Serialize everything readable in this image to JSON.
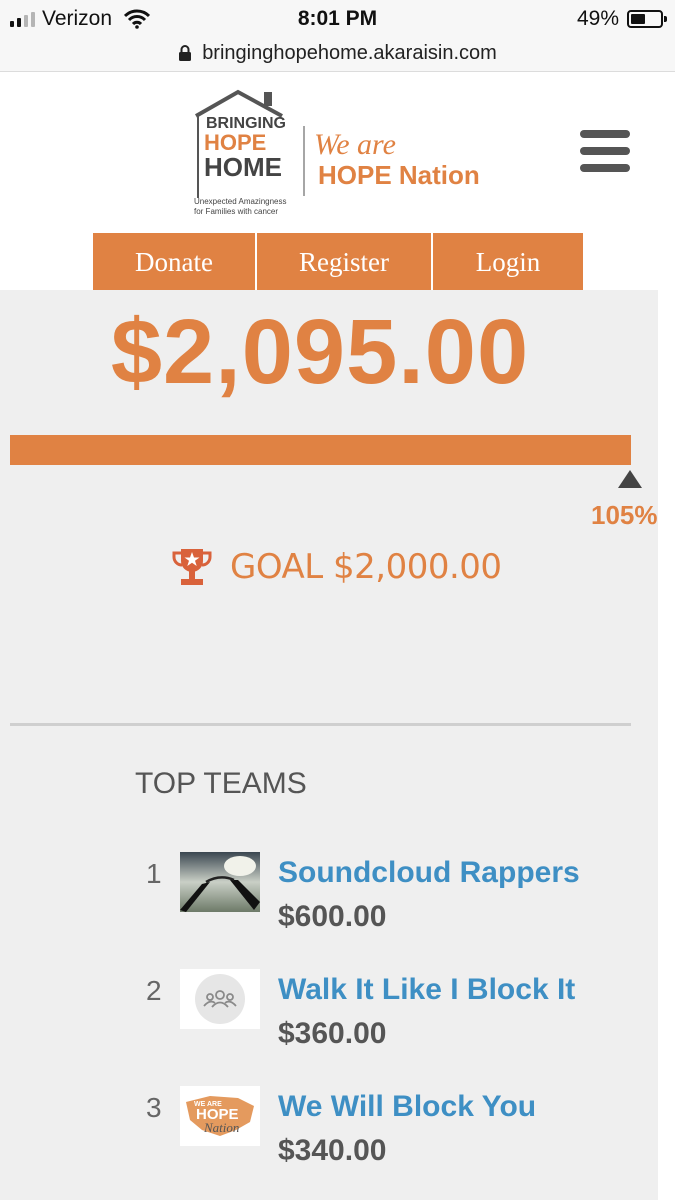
{
  "status_bar": {
    "carrier": "Verizon",
    "time": "8:01 PM",
    "battery": "49%",
    "battery_level": 0.49,
    "signal_bars_active": 2,
    "signal_bars_total": 4
  },
  "url_bar": {
    "url": "bringinghopehome.akaraisin.com",
    "icon": "lock-icon"
  },
  "logo": {
    "line1": "BRINGING",
    "line2": "HOPE",
    "line3": "HOME",
    "tagline1": "Unexpected Amazingness",
    "tagline2": "for Families with cancer",
    "slogan1": "We are",
    "slogan2": "HOPE Nation"
  },
  "nav": {
    "donate": "Donate",
    "register": "Register",
    "login": "Login"
  },
  "fundraising": {
    "raised": "$2,095.00",
    "progress_percent": 105,
    "percent_label": "105%",
    "goal_label": "GOAL $2,000.00"
  },
  "top_teams": {
    "title": "TOP TEAMS",
    "items": [
      {
        "rank": "1",
        "name": "Soundcloud Rappers",
        "amount": "$600.00"
      },
      {
        "rank": "2",
        "name": "Walk It Like I Block It",
        "amount": "$360.00"
      },
      {
        "rank": "3",
        "name": "We Will Block You",
        "amount": "$340.00",
        "thumb_text1": "WE ARE",
        "thumb_text2": "HOPE",
        "thumb_text3": "Nation"
      }
    ]
  },
  "colors": {
    "accent": "#e08243",
    "link": "#3e8fc4",
    "panel": "#efefef"
  }
}
